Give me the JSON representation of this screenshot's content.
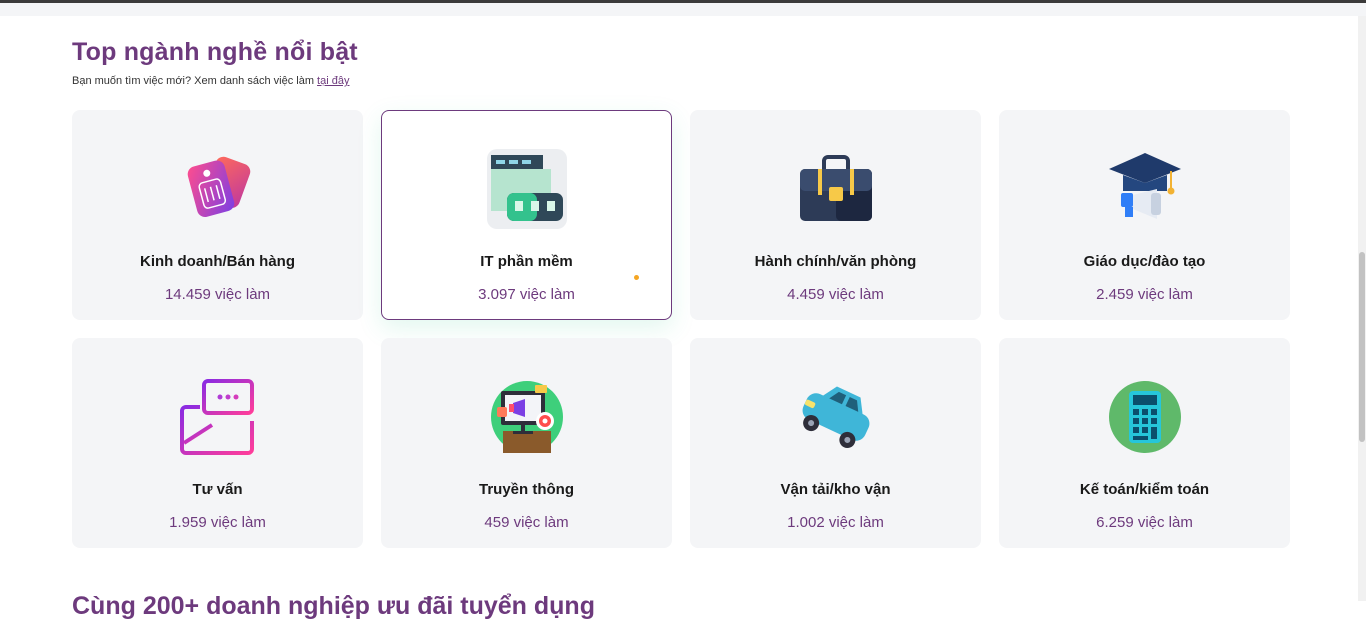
{
  "section": {
    "title": "Top ngành nghề nổi bật",
    "subtitle_prefix": "Bạn muốn tìm việc mới? Xem danh sách việc làm ",
    "subtitle_link": "tại đây"
  },
  "categories": [
    {
      "name": "Kinh doanh/Bán hàng",
      "count": "14.459 việc làm",
      "icon": "price-tag-icon"
    },
    {
      "name": "IT phần mềm",
      "count": "3.097 việc làm",
      "icon": "code-window-icon"
    },
    {
      "name": "Hành chính/văn phòng",
      "count": "4.459 việc làm",
      "icon": "briefcase-icon"
    },
    {
      "name": "Giáo dục/đào tạo",
      "count": "2.459 việc làm",
      "icon": "graduation-cap-icon"
    },
    {
      "name": "Tư vấn",
      "count": "1.959 việc làm",
      "icon": "chat-message-icon"
    },
    {
      "name": "Truyền thông",
      "count": "459 việc làm",
      "icon": "megaphone-screen-icon"
    },
    {
      "name": "Vận tải/kho vận",
      "count": "1.002 việc làm",
      "icon": "car-icon"
    },
    {
      "name": "Kế toán/kiểm toán",
      "count": "6.259 việc làm",
      "icon": "calculator-icon"
    }
  ],
  "next_section": {
    "title": "Cùng 200+ doanh nghiệp ưu đãi tuyển dụng"
  },
  "colors": {
    "accent": "#6d3a7d",
    "card_bg": "#f4f5f7"
  }
}
